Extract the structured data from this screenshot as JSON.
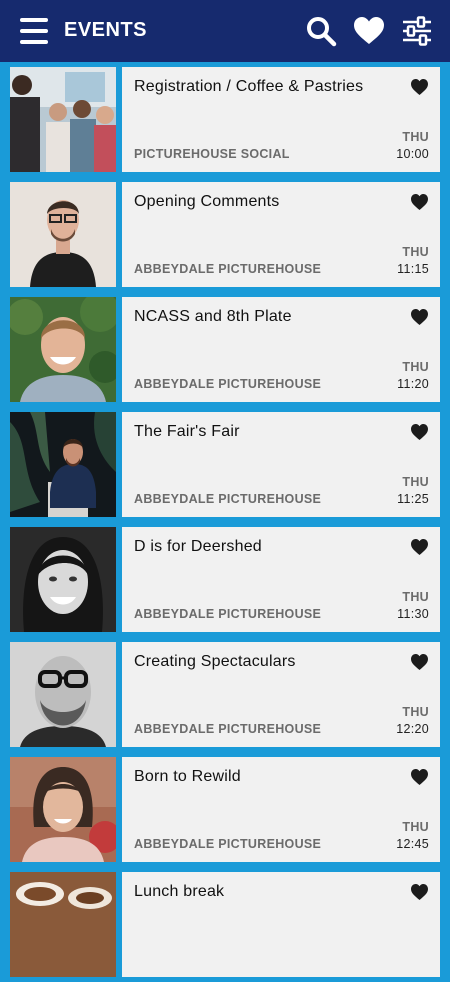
{
  "header": {
    "title": "EVENTS",
    "icons": [
      "menu-icon",
      "search-icon",
      "heart-icon",
      "filter-sliders-icon"
    ],
    "color": "#162a6e"
  },
  "accent_color": "#1a9bd8",
  "events": [
    {
      "title": "Registration / Coffee & Pastries",
      "venue": "PICTUREHOUSE SOCIAL",
      "day": "THU",
      "time": "10:00",
      "photo": "group-of-people-photo"
    },
    {
      "title": "Opening Comments",
      "venue": "ABBEYDALE PICTUREHOUSE",
      "day": "THU",
      "time": "11:15",
      "photo": "man-with-glasses-photo"
    },
    {
      "title": "NCASS and 8th Plate",
      "venue": "ABBEYDALE PICTUREHOUSE",
      "day": "THU",
      "time": "11:20",
      "photo": "smiling-man-photo"
    },
    {
      "title": "The Fair's Fair",
      "venue": "ABBEYDALE PICTUREHOUSE",
      "day": "THU",
      "time": "11:25",
      "photo": "seated-man-photo"
    },
    {
      "title": "D is for Deershed",
      "venue": "ABBEYDALE PICTUREHOUSE",
      "day": "THU",
      "time": "11:30",
      "photo": "woman-portrait-photo"
    },
    {
      "title": "Creating Spectaculars",
      "venue": "ABBEYDALE PICTUREHOUSE",
      "day": "THU",
      "time": "12:20",
      "photo": "bearded-man-photo"
    },
    {
      "title": "Born to Rewild",
      "venue": "ABBEYDALE PICTUREHOUSE",
      "day": "THU",
      "time": "12:45",
      "photo": "woman-with-fringe-photo"
    },
    {
      "title": "Lunch break",
      "venue": "",
      "day": "",
      "time": "",
      "photo": "coffee-cups-photo"
    }
  ]
}
